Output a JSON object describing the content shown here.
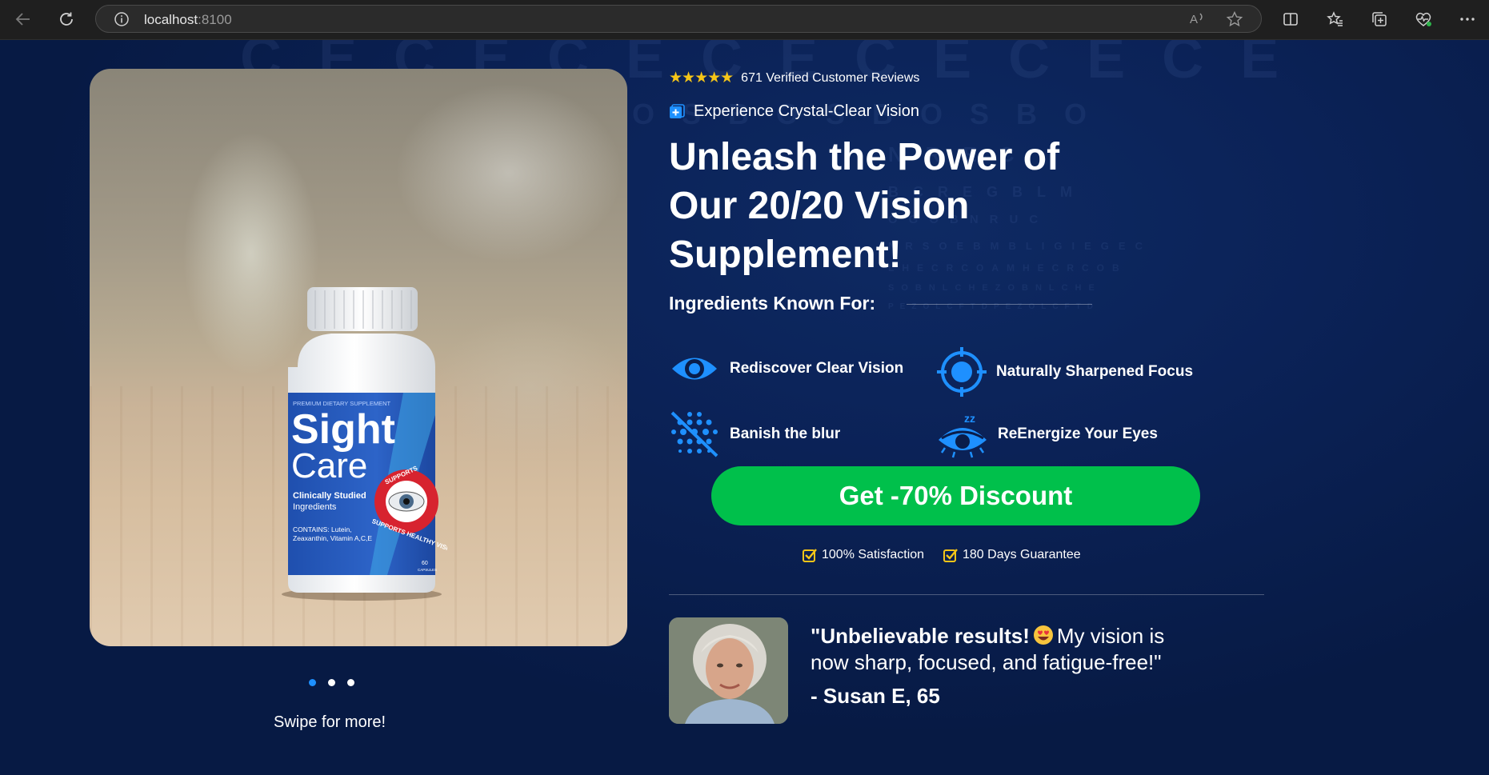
{
  "browser": {
    "url_host": "localhost",
    "url_port": ":8100"
  },
  "product": {
    "bottle": {
      "top_label": "PREMIUM DIETARY SUPPLEMENT",
      "brand_1": "Sight",
      "brand_2": "Care",
      "line_1": "Clinically Studied",
      "line_2": "Ingredients",
      "contains_1": "CONTAINS: Lutein,",
      "contains_2": "Zeaxanthin, Vitamin A,C,E",
      "seal_text": "SUPPORTS HEALTHY VISION",
      "count": "60",
      "count_unit": "CAPSULES"
    }
  },
  "carousel": {
    "swipe_text": "Swipe for more!",
    "slides": 3,
    "active_slide": 1
  },
  "rating": {
    "stars": "★★★★★",
    "text": "671 Verified Customer Reviews"
  },
  "tagline": "Experience Crystal-Clear Vision",
  "headline": {
    "line1": "Unleash the Power of",
    "line2": "Our 20/20 Vision",
    "line3": "Supplement!"
  },
  "ingredients": {
    "title": "Ingredients Known For:",
    "items": [
      {
        "label": "Rediscover Clear Vision",
        "icon": "eye-icon"
      },
      {
        "label": "Naturally Sharpened Focus",
        "icon": "crosshair-icon"
      },
      {
        "label": "Banish the blur",
        "icon": "blur-icon"
      },
      {
        "label": "ReEnergize Your Eyes",
        "icon": "sleepy-eye-icon"
      }
    ]
  },
  "cta": {
    "label": "Get -70% Discount"
  },
  "guarantees": [
    {
      "label": "100% Satisfaction",
      "icon": "checkbox-icon"
    },
    {
      "label": "180 Days Guarantee",
      "icon": "checkbox-icon"
    }
  ],
  "testimonial": {
    "quote_bold": "\"Unbelievable results!",
    "quote_rest_1": "My vision is",
    "quote_rest_2": "now sharp, focused, and fatigue-free!\"",
    "author": "- Susan E, 65",
    "emoji": "heart-eyes-emoji"
  },
  "colors": {
    "background": "#0a1d4a",
    "accent_blue": "#1e90ff",
    "cta_green": "#00c04b",
    "star_yellow": "#f5c518",
    "check_yellow": "#f5c518"
  }
}
